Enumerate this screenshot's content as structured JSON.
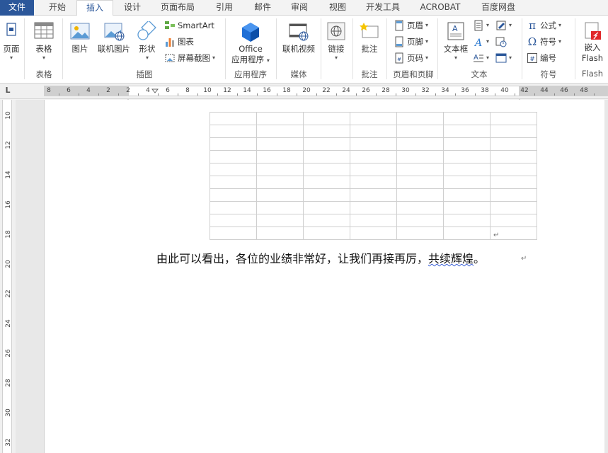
{
  "tabs": [
    "文件",
    "开始",
    "插入",
    "设计",
    "页面布局",
    "引用",
    "邮件",
    "审阅",
    "视图",
    "开发工具",
    "ACROBAT",
    "百度网盘"
  ],
  "active_tab": "插入",
  "ribbon": {
    "pages": {
      "label": "页面",
      "group": ""
    },
    "table": {
      "label": "表格",
      "group": "表格"
    },
    "illustrations": {
      "group": "插图",
      "picture": "图片",
      "online_picture": "联机图片",
      "shapes": "形状",
      "smartart": "SmartArt",
      "chart": "图表",
      "screenshot": "屏幕截图"
    },
    "apps": {
      "line1": "Office",
      "line2": "应用程序",
      "group": "应用程序"
    },
    "media": {
      "label": "联机视频",
      "group": "媒体"
    },
    "links": {
      "label": "链接",
      "group": ""
    },
    "comments": {
      "label": "批注",
      "group": "批注"
    },
    "header_footer": {
      "header": "页眉",
      "footer": "页脚",
      "page_number": "页码",
      "group": "页眉和页脚"
    },
    "text": {
      "textbox": "文本框",
      "group": "文本"
    },
    "symbols": {
      "equation": "公式",
      "symbol": "符号",
      "numbering": "编号",
      "group": "符号"
    },
    "flash": {
      "line1": "嵌入",
      "line2": "Flash",
      "group": "Flash"
    }
  },
  "ruler": {
    "corner": "L",
    "h_numbers": [
      "8",
      "6",
      "4",
      "2",
      "2",
      "4",
      "6",
      "8",
      "10",
      "12",
      "14",
      "16",
      "18",
      "20",
      "22",
      "24",
      "26",
      "28",
      "30",
      "32",
      "34",
      "36",
      "38",
      "40",
      "42",
      "44",
      "46",
      "48"
    ],
    "v_numbers": [
      "10",
      "12",
      "14",
      "16",
      "18",
      "20",
      "22",
      "24",
      "26",
      "28",
      "30",
      "32"
    ]
  },
  "document": {
    "table": {
      "rows": 10,
      "cols": 7
    },
    "text_main": "由此可以看出，各位的业绩非常好，让我们再接再厉，",
    "text_squiggle": "共续辉煌",
    "text_end": "。"
  },
  "colors": {
    "file_tab": "#2b579a",
    "accent": "#2b579a",
    "squiggle": "#3a5fd6"
  }
}
